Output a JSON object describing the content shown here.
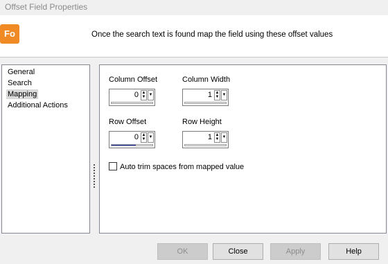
{
  "window": {
    "title": "Offset Field Properties"
  },
  "header": {
    "logo_text": "Fo",
    "text": "Once the search text is found map the field using these offset values"
  },
  "nav": {
    "items": [
      {
        "label": "General",
        "selected": false
      },
      {
        "label": "Search",
        "selected": false
      },
      {
        "label": "Mapping",
        "selected": true
      },
      {
        "label": "Additional Actions",
        "selected": false
      }
    ]
  },
  "fields": {
    "column_offset": {
      "label": "Column Offset",
      "value": "0"
    },
    "column_width": {
      "label": "Column Width",
      "value": "1"
    },
    "row_offset": {
      "label": "Row Offset",
      "value": "0"
    },
    "row_height": {
      "label": "Row Height",
      "value": "1"
    }
  },
  "auto_trim": {
    "label": "Auto trim spaces from mapped value",
    "checked": false
  },
  "buttons": {
    "ok": "OK",
    "close": "Close",
    "apply": "Apply",
    "help": "Help"
  },
  "colors": {
    "accent": "#f08a24",
    "focus_bar": "#1e2fa8"
  },
  "icons": {
    "up_arrow": "triangle-up",
    "down_arrow": "triangle-down",
    "dropdown": "chevron-down"
  }
}
